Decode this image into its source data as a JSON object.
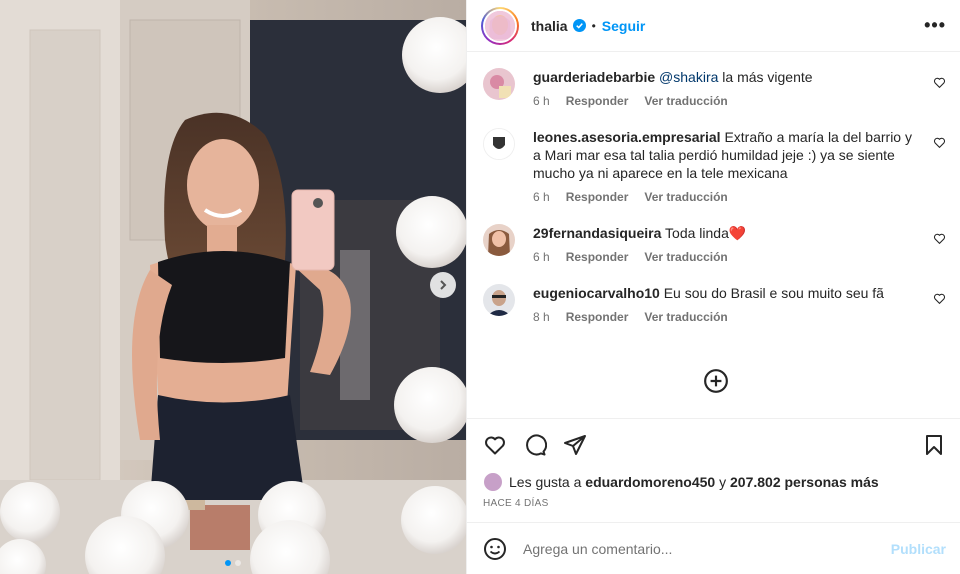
{
  "post": {
    "username": "thalia",
    "follow_label": "Seguir",
    "separator": "•",
    "more_label": "•••"
  },
  "comments": [
    {
      "username": "guarderiadebarbie",
      "mention": "@shakira",
      "text": " la más vigente",
      "time": "6 h",
      "reply": "Responder",
      "translate": "Ver traducción"
    },
    {
      "username": "leones.asesoria.empresarial",
      "mention": "",
      "text": " Extraño a maría la del barrio y a Mari mar esa tal talia perdió humildad jeje :) ya se siente mucho ya ni aparece en la tele mexicana",
      "time": "6 h",
      "reply": "Responder",
      "translate": "Ver traducción"
    },
    {
      "username": "29fernandasiqueira",
      "mention": "",
      "text": " Toda linda❤️",
      "time": "6 h",
      "reply": "Responder",
      "translate": "Ver traducción"
    },
    {
      "username": "eugeniocarvalho10",
      "mention": "",
      "text": " Eu sou do Brasil e sou muito seu fã",
      "time": "8 h",
      "reply": "Responder",
      "translate": "Ver traducción"
    }
  ],
  "likes": {
    "prefix": "Les gusta a ",
    "user": "eduardomoreno450",
    "middle": " y ",
    "count": "207.802 personas más"
  },
  "posted_ago": "HACE 4 DÍAS",
  "composer": {
    "placeholder": "Agrega un comentario...",
    "post_label": "Publicar"
  },
  "colors": {
    "accent": "#0095f6",
    "muted": "#737373",
    "publish_disabled": "#b2dffc"
  },
  "carousel": {
    "current": 1,
    "total": 2
  }
}
